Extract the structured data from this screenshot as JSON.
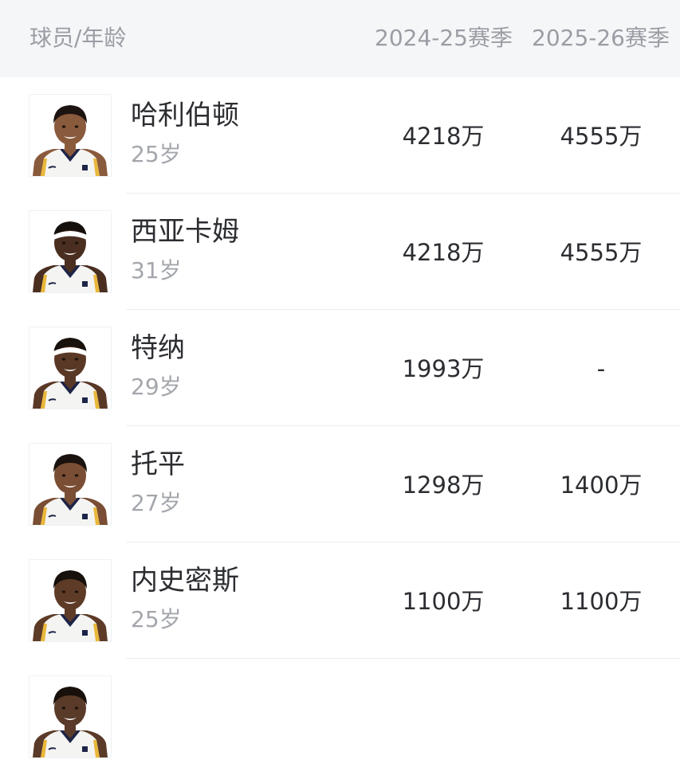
{
  "header": {
    "player_age": "球员/年龄",
    "season1": "2024-25赛季",
    "season2": "2025-26赛季"
  },
  "players": [
    {
      "name": "哈利伯顿",
      "age": "25岁",
      "salary_2425": "4218万",
      "salary_2526": "4555万",
      "skin": "#8a5a3c",
      "hair": "#1c1410",
      "headband": ""
    },
    {
      "name": "西亚卡姆",
      "age": "31岁",
      "salary_2425": "4218万",
      "salary_2526": "4555万",
      "skin": "#4a2e20",
      "hair": "#15100c",
      "headband": "#ffffff"
    },
    {
      "name": "特纳",
      "age": "29岁",
      "salary_2425": "1993万",
      "salary_2526": "-",
      "skin": "#5a3826",
      "hair": "#18110c",
      "headband": "#ffffff"
    },
    {
      "name": "托平",
      "age": "27岁",
      "salary_2425": "1298万",
      "salary_2526": "1400万",
      "skin": "#7a4e34",
      "hair": "#1a120e",
      "headband": ""
    },
    {
      "name": "内史密斯",
      "age": "25岁",
      "salary_2425": "1100万",
      "salary_2526": "1100万",
      "skin": "#5e3b27",
      "hair": "#17100b",
      "headband": ""
    },
    {
      "name": "",
      "age": "",
      "salary_2425": "",
      "salary_2526": "",
      "skin": "#5a3a28",
      "hair": "#17100b",
      "headband": ""
    }
  ]
}
